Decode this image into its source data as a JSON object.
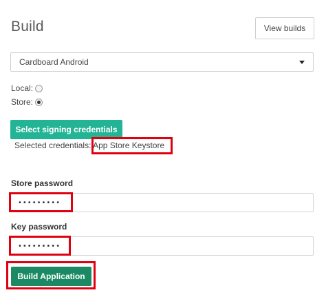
{
  "page": {
    "title": "Build",
    "view_builds_label": "View builds"
  },
  "project_select": {
    "selected": "Cardboard Android",
    "icon": "caret-down-icon"
  },
  "distribution": {
    "local_label": "Local:",
    "store_label": "Store:",
    "selected": "Store"
  },
  "signing": {
    "button_label": "Select signing credentials",
    "selected_prefix": "Selected credentials:",
    "selected_value": "App Store Keystore"
  },
  "store_password": {
    "label": "Store password",
    "value": "•••••••••"
  },
  "key_password": {
    "label": "Key password",
    "value": "•••••••••"
  },
  "actions": {
    "build_label": "Build Application"
  },
  "colors": {
    "signing_button": "#22b494",
    "build_button": "#1b8a64",
    "highlight": "#e0000f"
  }
}
